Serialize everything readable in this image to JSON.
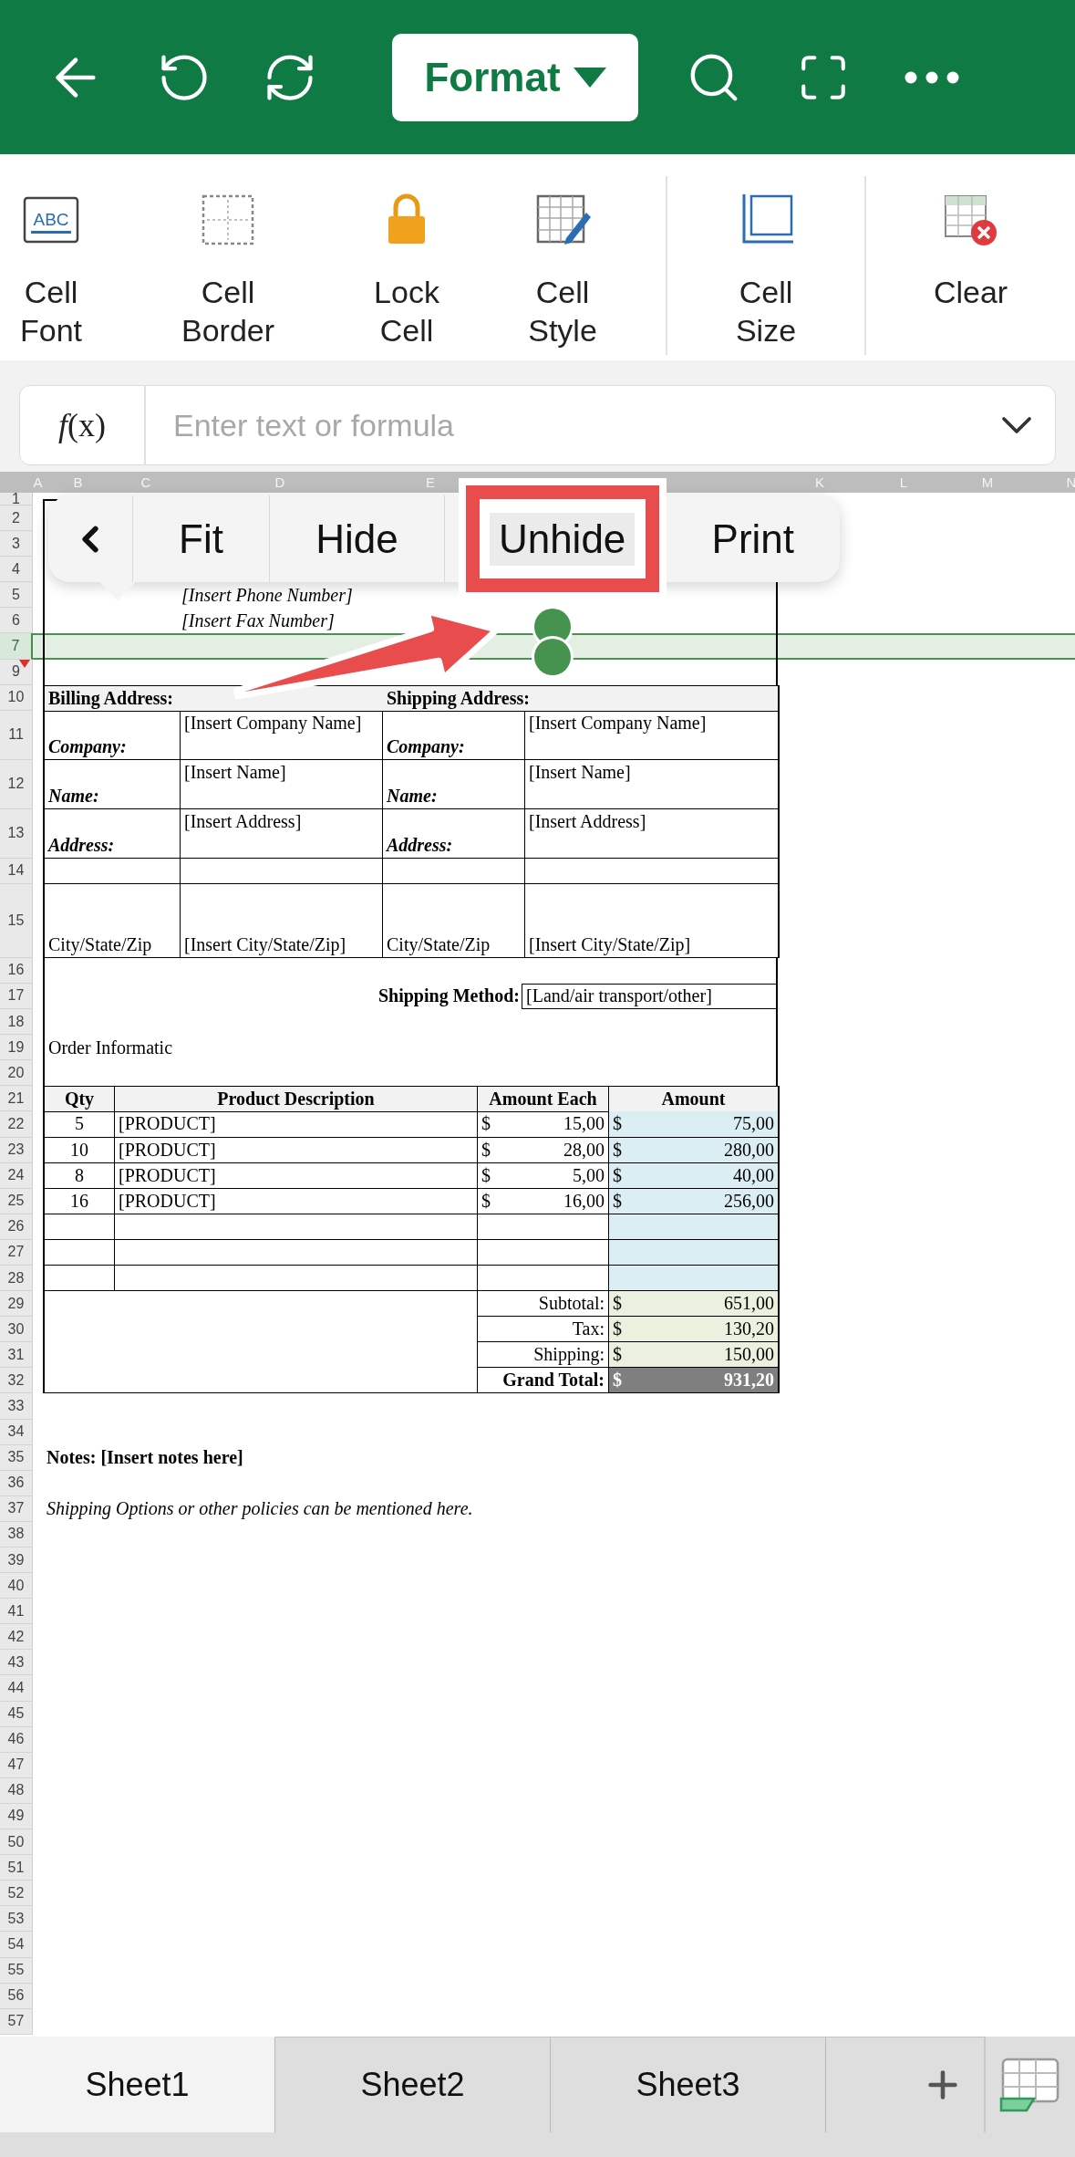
{
  "toolbar": {
    "format_button": "Format"
  },
  "ribbon": [
    {
      "kind": "font",
      "label": "Cell Font",
      "icon_text": "ABC"
    },
    {
      "kind": "border",
      "label": "Cell Border"
    },
    {
      "kind": "lock",
      "label": "Lock Cell"
    },
    {
      "kind": "style",
      "label": "Cell Style"
    },
    {
      "kind": "size",
      "label": "Cell Size"
    },
    {
      "kind": "clear",
      "label": "Clear"
    }
  ],
  "formula_bar": {
    "function_label": "*f*(x)",
    "placeholder": "Enter text or formula"
  },
  "column_headers": [
    "A",
    "B",
    "C",
    "D",
    "E",
    "K",
    "L",
    "M",
    "N"
  ],
  "context_menu": {
    "items": [
      {
        "label": "Fit",
        "annotated": false
      },
      {
        "label": "Hide",
        "annotated": false
      },
      {
        "label": "Unhide",
        "annotated": true
      },
      {
        "label": "Print",
        "annotated": false
      }
    ]
  },
  "rows": [
    {
      "number": "1",
      "kind": "form_top",
      "selected": false,
      "hidden_before": false
    },
    {
      "number": "2",
      "kind": "form_blank",
      "selected": false,
      "hidden_before": false
    },
    {
      "number": "3",
      "kind": "form_blank",
      "selected": false,
      "hidden_before": false
    },
    {
      "number": "4",
      "kind": "form_blank",
      "selected": false,
      "hidden_before": false
    },
    {
      "number": "5",
      "kind": "contact",
      "text": "[Insert Phone Number]",
      "selected": false,
      "hidden_before": false
    },
    {
      "number": "6",
      "kind": "contact",
      "text": "[Insert Fax Number]",
      "selected": false,
      "hidden_before": false
    },
    {
      "number": "7",
      "kind": "form_blank",
      "selected": true,
      "hidden_before": false
    },
    {
      "number": "9",
      "kind": "form_blank",
      "selected": false,
      "hidden_before": true
    },
    {
      "number": "10",
      "kind": "section_header",
      "cells": [
        "Billing Address:",
        "Shipping Address:"
      ],
      "selected": false,
      "hidden_before": false
    },
    {
      "number": "11",
      "kind": "address",
      "cells": [
        "Company:",
        "[Insert Company Name]",
        "Company:",
        "[Insert Company Name]"
      ],
      "selected": false,
      "hidden_before": false
    },
    {
      "number": "12",
      "kind": "address",
      "cells": [
        "Name:",
        "[Insert Name]",
        "Name:",
        "[Insert Name]"
      ],
      "selected": false,
      "hidden_before": false
    },
    {
      "number": "13",
      "kind": "address",
      "cells": [
        "Address:",
        "[Insert Address]",
        "Address:",
        "[Insert Address]"
      ],
      "selected": false,
      "hidden_before": false
    },
    {
      "number": "14",
      "kind": "address_blank",
      "selected": false,
      "hidden_before": false
    },
    {
      "number": "15",
      "kind": "city",
      "cells": [
        "City/State/Zip",
        "[Insert City/State/Zip]",
        "City/State/Zip",
        "[Insert City/State/Zip]"
      ],
      "selected": false,
      "hidden_before": false
    },
    {
      "number": "16",
      "kind": "form_blank",
      "selected": false,
      "hidden_before": false
    },
    {
      "number": "17",
      "kind": "shipping_method",
      "cells": [
        "Shipping Method:",
        "[Land/air transport/other]"
      ],
      "selected": false,
      "hidden_before": false
    },
    {
      "number": "18",
      "kind": "form_blank",
      "selected": false,
      "hidden_before": false
    },
    {
      "number": "19",
      "kind": "order_info",
      "text": "Order Informatic",
      "selected": false,
      "hidden_before": false
    },
    {
      "number": "20",
      "kind": "form_blank",
      "selected": false,
      "hidden_before": false
    },
    {
      "number": "21",
      "kind": "order_header",
      "cells": [
        "Qty",
        "Product Description",
        "Amount Each",
        "Amount"
      ],
      "selected": false,
      "hidden_before": false
    },
    {
      "number": "22",
      "kind": "item",
      "qty": "5",
      "description": "[PRODUCT]",
      "each_currency": "$",
      "each": "15,00",
      "amount_currency": "$",
      "amount": "75,00",
      "selected": false,
      "hidden_before": false
    },
    {
      "number": "23",
      "kind": "item",
      "qty": "10",
      "description": "[PRODUCT]",
      "each_currency": "$",
      "each": "28,00",
      "amount_currency": "$",
      "amount": "280,00",
      "selected": false,
      "hidden_before": false
    },
    {
      "number": "24",
      "kind": "item",
      "qty": "8",
      "description": "[PRODUCT]",
      "each_currency": "$",
      "each": "5,00",
      "amount_currency": "$",
      "amount": "40,00",
      "selected": false,
      "hidden_before": false
    },
    {
      "number": "25",
      "kind": "item",
      "qty": "16",
      "description": "[PRODUCT]",
      "each_currency": "$",
      "each": "16,00",
      "amount_currency": "$",
      "amount": "256,00",
      "selected": false,
      "hidden_before": false
    },
    {
      "number": "26",
      "kind": "item_blank",
      "selected": false,
      "hidden_before": false
    },
    {
      "number": "27",
      "kind": "item_blank",
      "selected": false,
      "hidden_before": false
    },
    {
      "number": "28",
      "kind": "item_blank",
      "selected": false,
      "hidden_before": false
    },
    {
      "number": "29",
      "kind": "total",
      "label": "Subtotal:",
      "currency": "$",
      "amount": "651,00",
      "selected": false,
      "hidden_before": false
    },
    {
      "number": "30",
      "kind": "total",
      "label": "Tax:",
      "currency": "$",
      "amount": "130,20",
      "selected": false,
      "hidden_before": false
    },
    {
      "number": "31",
      "kind": "total",
      "label": "Shipping:",
      "currency": "$",
      "amount": "150,00",
      "selected": false,
      "hidden_before": false
    },
    {
      "number": "32",
      "kind": "grand_total",
      "label": "Grand Total:",
      "currency": "$",
      "amount": "931,20",
      "selected": false,
      "hidden_before": false
    },
    {
      "number": "33",
      "kind": "empty",
      "selected": false,
      "hidden_before": false
    },
    {
      "number": "34",
      "kind": "empty",
      "selected": false,
      "hidden_before": false
    },
    {
      "number": "35",
      "kind": "note",
      "text": "Notes: [Insert notes here]",
      "selected": false,
      "hidden_before": false
    },
    {
      "number": "36",
      "kind": "empty",
      "selected": false,
      "hidden_before": false
    },
    {
      "number": "37",
      "kind": "policy",
      "text": "Shipping Options or other policies can be mentioned here.",
      "selected": false,
      "hidden_before": false
    },
    {
      "number": "38",
      "kind": "empty",
      "selected": false,
      "hidden_before": false
    },
    {
      "number": "39",
      "kind": "empty",
      "selected": false,
      "hidden_before": false
    },
    {
      "number": "40",
      "kind": "empty",
      "selected": false,
      "hidden_before": false
    },
    {
      "number": "41",
      "kind": "empty",
      "selected": false,
      "hidden_before": false
    },
    {
      "number": "42",
      "kind": "empty",
      "selected": false,
      "hidden_before": false
    },
    {
      "number": "43",
      "kind": "empty",
      "selected": false,
      "hidden_before": false
    },
    {
      "number": "44",
      "kind": "empty",
      "selected": false,
      "hidden_before": false
    },
    {
      "number": "45",
      "kind": "empty",
      "selected": false,
      "hidden_before": false
    },
    {
      "number": "46",
      "kind": "empty",
      "selected": false,
      "hidden_before": false
    },
    {
      "number": "47",
      "kind": "empty",
      "selected": false,
      "hidden_before": false
    },
    {
      "number": "48",
      "kind": "empty",
      "selected": false,
      "hidden_before": false
    },
    {
      "number": "49",
      "kind": "empty",
      "selected": false,
      "hidden_before": false
    },
    {
      "number": "50",
      "kind": "empty",
      "selected": false,
      "hidden_before": false
    },
    {
      "number": "51",
      "kind": "empty",
      "selected": false,
      "hidden_before": false
    },
    {
      "number": "52",
      "kind": "empty",
      "selected": false,
      "hidden_before": false
    },
    {
      "number": "53",
      "kind": "empty",
      "selected": false,
      "hidden_before": false
    },
    {
      "number": "54",
      "kind": "empty",
      "selected": false,
      "hidden_before": false
    },
    {
      "number": "55",
      "kind": "empty",
      "selected": false,
      "hidden_before": false
    },
    {
      "number": "56",
      "kind": "empty",
      "selected": false,
      "hidden_before": false
    },
    {
      "number": "57",
      "kind": "empty",
      "selected": false,
      "hidden_before": false
    }
  ],
  "sheet_tabs": [
    {
      "label": "Sheet1",
      "selected": true
    },
    {
      "label": "Sheet2",
      "selected": false
    },
    {
      "label": "Sheet3",
      "selected": false
    }
  ]
}
